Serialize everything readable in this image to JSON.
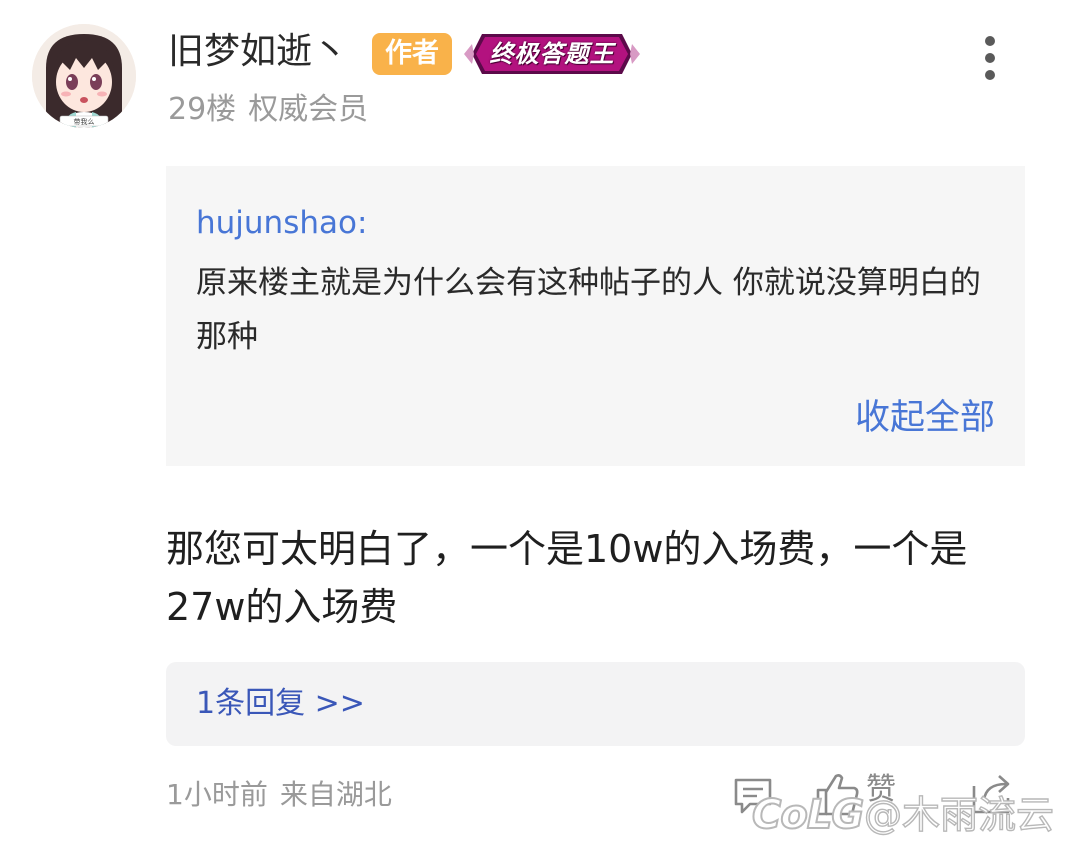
{
  "post": {
    "username": "旧梦如逝丶",
    "author_badge": "作者",
    "title_badge": "终极答题王",
    "floor": "29楼",
    "member_level": "权威会员"
  },
  "quote": {
    "user": "hujunshao:",
    "text": "原来楼主就是为什么会有这种帖子的人 你就说没算明白的那种",
    "collapse_label": "收起全部"
  },
  "reply": {
    "text": "那您可太明白了，一个是10w的入场费，一个是27w的入场费"
  },
  "subreply": {
    "label": "1条回复 >>"
  },
  "footer": {
    "time": "1小时前",
    "location": "来自湖北",
    "like_label": "赞"
  },
  "watermark": {
    "logo": "CoLG",
    "text": "@木雨流云"
  },
  "avatar": {
    "caption": "带我么"
  },
  "colors": {
    "link_blue": "#4876d6",
    "author_badge": "#f9b24a",
    "title_badge": "#a5117a",
    "quote_bg": "#f6f6f6",
    "meta_gray": "#9a9a9a"
  },
  "icons": [
    "more-vertical-icon",
    "reply-icon",
    "like-icon",
    "share-icon"
  ]
}
